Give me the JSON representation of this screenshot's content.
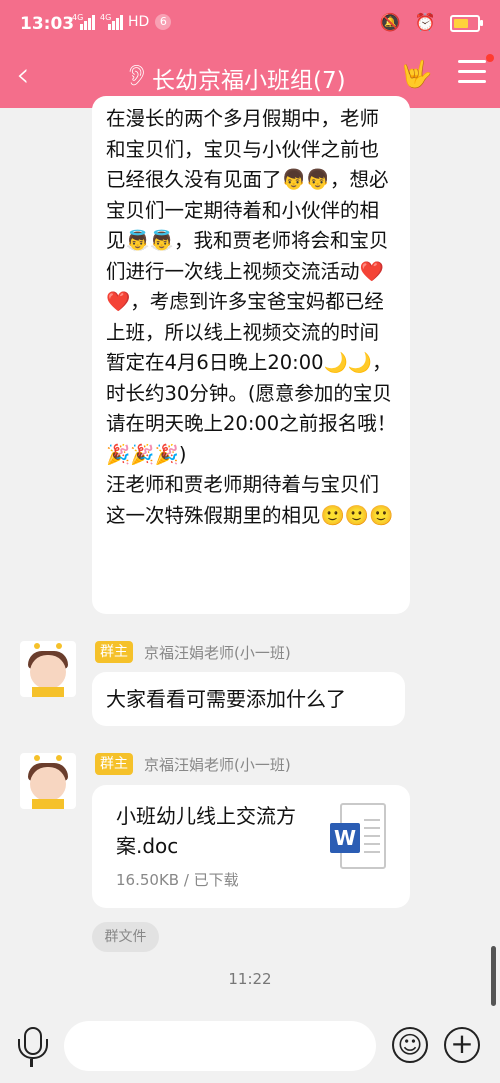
{
  "status_bar": {
    "time": "13:03",
    "network": "HD",
    "notification_count": "6",
    "signal_label": "4G"
  },
  "header": {
    "back_icon": "chevron-left-icon",
    "title": "长幼京福小班组(7)",
    "accent": "#f46e8b"
  },
  "messages": {
    "long_text": "在漫长的两个多月假期中，老师和宝贝们，宝贝与小伙伴之前也已经很久没有见面了👦👦，想必宝贝们一定期待着和小伙伴的相见👼👼，我和贾老师将会和宝贝们进行一次线上视频交流活动❤️❤️，考虑到许多宝爸宝妈都已经上班，所以线上视频交流的时间暂定在4月6日晚上20:00🌙🌙，时长约30分钟。(愿意参加的宝贝请在明天晚上20:00之前报名哦！🎉🎉🎉)\n汪老师和贾老师期待着与宝贝们这一次特殊假期里的相见🙂🙂🙂",
    "msg1": {
      "role": "群主",
      "sender": "京福汪娟老师(小一班)",
      "text": "大家看看可需要添加什么了"
    },
    "msg2": {
      "role": "群主",
      "sender": "京福汪娟老师(小一班)",
      "file_name": "小班幼儿线上交流方案.doc",
      "file_info": "16.50KB / 已下载",
      "doc_letter": "W"
    },
    "source_chip": "群文件",
    "timestamp": "11:22"
  }
}
